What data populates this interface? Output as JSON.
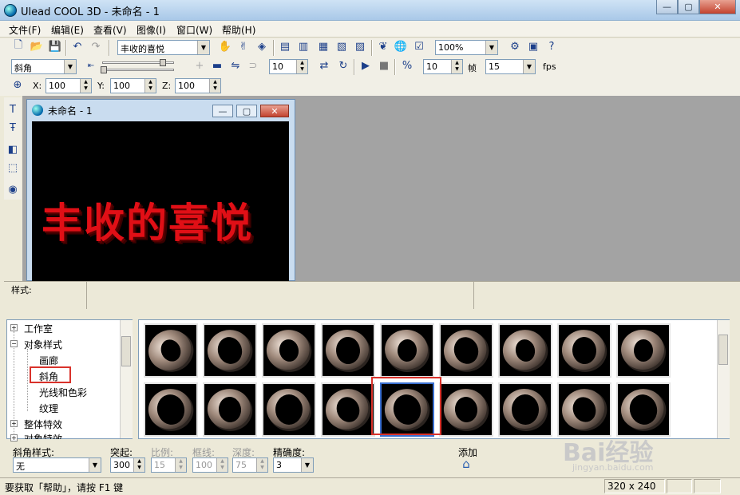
{
  "window": {
    "title": "Ulead COOL 3D - 未命名 - 1",
    "minimize": "—",
    "maximize": "▢",
    "close": "✕"
  },
  "menu": [
    "文件(F)",
    "编辑(E)",
    "查看(V)",
    "图像(I)",
    "窗口(W)",
    "帮助(H)"
  ],
  "toolbar1": {
    "text_object": "丰收的喜悦",
    "zoom": "100%"
  },
  "toolbar2": {
    "bevel_select": "斜角",
    "frame_value": "10",
    "frames_value": "10",
    "frame_label": "帧",
    "fps_value": "15",
    "fps_label": "fps"
  },
  "toolbar3": {
    "x_label": "X:",
    "x_value": "100",
    "y_label": "Y:",
    "y_value": "100",
    "z_label": "Z:",
    "z_value": "100"
  },
  "doc": {
    "title": "未命名 - 1",
    "canvas_text": "丰收的喜悦",
    "canvas_text_color": "#e00f16",
    "minimize": "—",
    "maximize": "▢",
    "close": "✕"
  },
  "style_label": "样式:",
  "tree": [
    {
      "label": "工作室",
      "expander": "+"
    },
    {
      "label": "对象样式",
      "expander": "−"
    },
    {
      "label": "画廊"
    },
    {
      "label": "斜角"
    },
    {
      "label": "光线和色彩"
    },
    {
      "label": "纹理"
    },
    {
      "label": "整体特效",
      "expander": "+"
    },
    {
      "label": "对象特效",
      "expander": "+"
    }
  ],
  "props": {
    "bevel_style_label": "斜角样式:",
    "bevel_style_value": "无",
    "extrude_label": "突起:",
    "extrude_value": "300",
    "ratio_label": "比例:",
    "ratio_value": "15",
    "border_label": "框线:",
    "border_value": "100",
    "depth_label": "深度:",
    "depth_value": "75",
    "precision_label": "精确度:",
    "precision_value": "3",
    "add_label": "添加"
  },
  "status": {
    "help": "要获取「帮助」，请按 F1 键",
    "size": "320 x 240"
  },
  "watermark": {
    "text": "Bai经验",
    "url": "jingyan.baidu.com"
  }
}
